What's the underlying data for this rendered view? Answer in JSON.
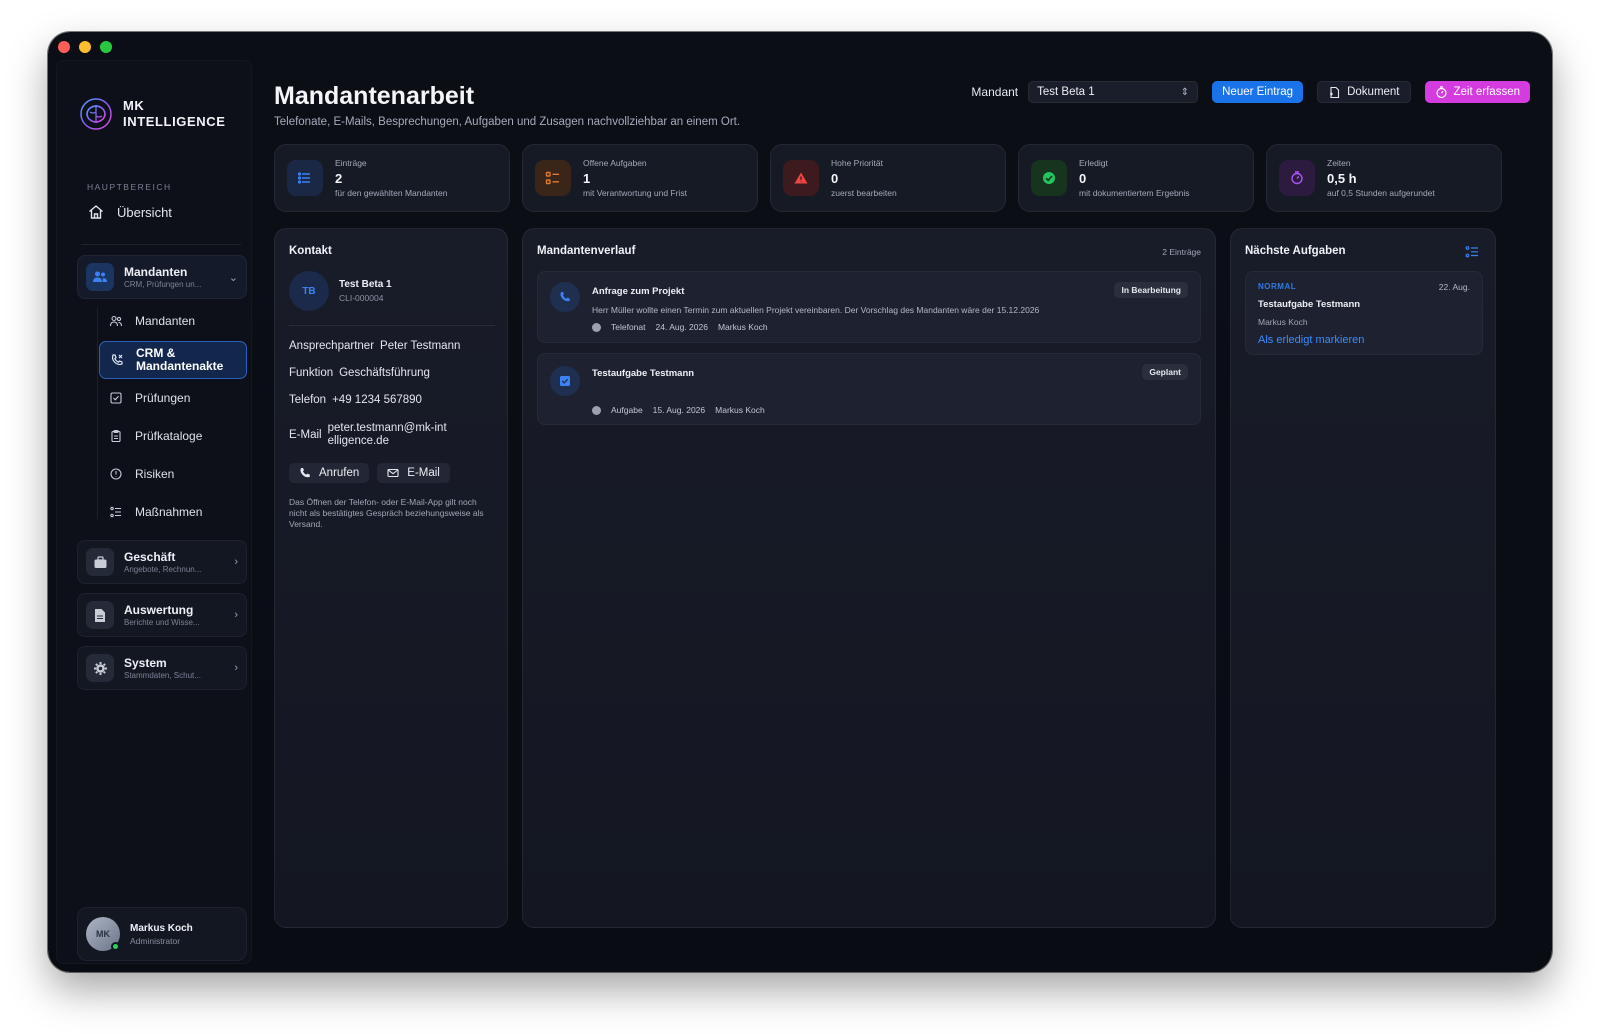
{
  "brand": {
    "line1": "MK",
    "line2": "INTELLIGENCE"
  },
  "sidebar": {
    "section_label": "HAUPTBEREICH",
    "overview": "Übersicht",
    "groups": [
      {
        "title": "Mandanten",
        "subtitle": "CRM, Prüfungen un...",
        "icon": "users-icon",
        "state": "expanded"
      },
      {
        "title": "Geschäft",
        "subtitle": "Angebote, Rechnun...",
        "icon": "briefcase-icon",
        "state": "collapsed"
      },
      {
        "title": "Auswertung",
        "subtitle": "Berichte und Wisse...",
        "icon": "document-icon",
        "state": "collapsed"
      },
      {
        "title": "System",
        "subtitle": "Stammdaten, Schut...",
        "icon": "gear-icon",
        "state": "collapsed"
      }
    ],
    "subitems": [
      {
        "label": "Mandanten",
        "icon": "users-icon"
      },
      {
        "label": "CRM &\nMandantenakte",
        "icon": "phone-icon",
        "active": true
      },
      {
        "label": "Prüfungen",
        "icon": "checkbox-icon"
      },
      {
        "label": "Prüfkataloge",
        "icon": "clipboard-icon"
      },
      {
        "label": "Risiken",
        "icon": "alert-circle-icon"
      },
      {
        "label": "Maßnahmen",
        "icon": "list-icon"
      }
    ],
    "user": {
      "initials": "MK",
      "name": "Markus Koch",
      "role": "Administrator",
      "status_color": "#2bd159"
    }
  },
  "header": {
    "title": "Mandantenarbeit",
    "subtitle": "Telefonate, E-Mails, Besprechungen, Aufgaben und Zusagen nachvollziehbar an einem Ort.",
    "mandant_label": "Mandant",
    "mandant_value": "Test Beta 1",
    "buttons": {
      "new_entry": "Neuer Eintrag",
      "document": "Dokument",
      "track_time": "Zeit erfassen"
    },
    "colors": {
      "primary": "#1a73e8",
      "accent": "#d53ce0"
    }
  },
  "stats": [
    {
      "label": "Einträge",
      "value": "2",
      "desc": "für den gewählten Mandanten",
      "icon": "list-icon",
      "color": "#3b82f6"
    },
    {
      "label": "Offene Aufgaben",
      "value": "1",
      "desc": "mit Verantwortung und Frist",
      "icon": "tasks-icon",
      "color": "#e07a2f"
    },
    {
      "label": "Hohe Priorität",
      "value": "0",
      "desc": "zuerst bearbeiten",
      "icon": "warning-icon",
      "color": "#ef4444"
    },
    {
      "label": "Erledigt",
      "value": "0",
      "desc": "mit dokumentiertem Ergebnis",
      "icon": "check-badge-icon",
      "color": "#22c55e"
    },
    {
      "label": "Zeiten",
      "value": "0,5 h",
      "desc": "auf 0,5 Stunden aufgerundet",
      "icon": "timer-icon",
      "color": "#a855f7"
    }
  ],
  "contact": {
    "title": "Kontakt",
    "initials": "TB",
    "name": "Test Beta 1",
    "id": "CLI-000004",
    "fields": [
      {
        "key": "Ansprechpartner",
        "value": "Peter Testmann"
      },
      {
        "key": "Funktion",
        "value": "Geschäftsführung"
      },
      {
        "key": "Telefon",
        "value": "+49 1234 567890"
      },
      {
        "key": "E-Mail",
        "value": "peter.testmann@mk-intelligence.de"
      }
    ],
    "call_label": "Anrufen",
    "email_label": "E-Mail",
    "note": "Das Öffnen der Telefon- oder E-Mail-App gilt noch nicht als bestätigtes Gespräch beziehungsweise als Versand."
  },
  "history": {
    "title": "Mandantenverlauf",
    "count": "2 Einträge",
    "entries": [
      {
        "title": "Anfrage zum Projekt",
        "text": "Herr Müller wollte einen Termin zum aktuellen Projekt vereinbaren. Der Vorschlag des Mandanten wäre der 15.12.2026",
        "type": "Telefonat",
        "date": "24. Aug. 2026",
        "person": "Markus Koch",
        "status": "In Bearbeitung",
        "icon": "phone-icon"
      },
      {
        "title": "Testaufgabe Testmann",
        "text": "",
        "type": "Aufgabe",
        "date": "15. Aug. 2026",
        "person": "Markus Koch",
        "status": "Geplant",
        "icon": "checkbox-icon"
      }
    ]
  },
  "next_tasks": {
    "title": "Nächste Aufgaben",
    "items": [
      {
        "priority": "NORMAL",
        "date": "22. Aug.",
        "title": "Testaufgabe Testmann",
        "person": "Markus Koch",
        "action": "Als erledigt markieren"
      }
    ]
  }
}
